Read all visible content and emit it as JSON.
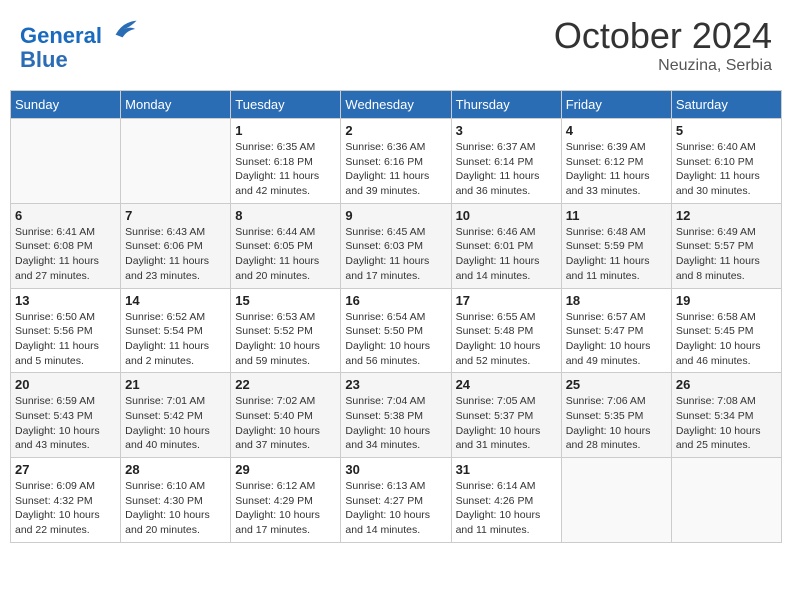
{
  "header": {
    "logo_line1": "General",
    "logo_line2": "Blue",
    "month": "October 2024",
    "location": "Neuzina, Serbia"
  },
  "weekdays": [
    "Sunday",
    "Monday",
    "Tuesday",
    "Wednesday",
    "Thursday",
    "Friday",
    "Saturday"
  ],
  "weeks": [
    [
      {
        "day": "",
        "info": ""
      },
      {
        "day": "",
        "info": ""
      },
      {
        "day": "1",
        "info": "Sunrise: 6:35 AM\nSunset: 6:18 PM\nDaylight: 11 hours and 42 minutes."
      },
      {
        "day": "2",
        "info": "Sunrise: 6:36 AM\nSunset: 6:16 PM\nDaylight: 11 hours and 39 minutes."
      },
      {
        "day": "3",
        "info": "Sunrise: 6:37 AM\nSunset: 6:14 PM\nDaylight: 11 hours and 36 minutes."
      },
      {
        "day": "4",
        "info": "Sunrise: 6:39 AM\nSunset: 6:12 PM\nDaylight: 11 hours and 33 minutes."
      },
      {
        "day": "5",
        "info": "Sunrise: 6:40 AM\nSunset: 6:10 PM\nDaylight: 11 hours and 30 minutes."
      }
    ],
    [
      {
        "day": "6",
        "info": "Sunrise: 6:41 AM\nSunset: 6:08 PM\nDaylight: 11 hours and 27 minutes."
      },
      {
        "day": "7",
        "info": "Sunrise: 6:43 AM\nSunset: 6:06 PM\nDaylight: 11 hours and 23 minutes."
      },
      {
        "day": "8",
        "info": "Sunrise: 6:44 AM\nSunset: 6:05 PM\nDaylight: 11 hours and 20 minutes."
      },
      {
        "day": "9",
        "info": "Sunrise: 6:45 AM\nSunset: 6:03 PM\nDaylight: 11 hours and 17 minutes."
      },
      {
        "day": "10",
        "info": "Sunrise: 6:46 AM\nSunset: 6:01 PM\nDaylight: 11 hours and 14 minutes."
      },
      {
        "day": "11",
        "info": "Sunrise: 6:48 AM\nSunset: 5:59 PM\nDaylight: 11 hours and 11 minutes."
      },
      {
        "day": "12",
        "info": "Sunrise: 6:49 AM\nSunset: 5:57 PM\nDaylight: 11 hours and 8 minutes."
      }
    ],
    [
      {
        "day": "13",
        "info": "Sunrise: 6:50 AM\nSunset: 5:56 PM\nDaylight: 11 hours and 5 minutes."
      },
      {
        "day": "14",
        "info": "Sunrise: 6:52 AM\nSunset: 5:54 PM\nDaylight: 11 hours and 2 minutes."
      },
      {
        "day": "15",
        "info": "Sunrise: 6:53 AM\nSunset: 5:52 PM\nDaylight: 10 hours and 59 minutes."
      },
      {
        "day": "16",
        "info": "Sunrise: 6:54 AM\nSunset: 5:50 PM\nDaylight: 10 hours and 56 minutes."
      },
      {
        "day": "17",
        "info": "Sunrise: 6:55 AM\nSunset: 5:48 PM\nDaylight: 10 hours and 52 minutes."
      },
      {
        "day": "18",
        "info": "Sunrise: 6:57 AM\nSunset: 5:47 PM\nDaylight: 10 hours and 49 minutes."
      },
      {
        "day": "19",
        "info": "Sunrise: 6:58 AM\nSunset: 5:45 PM\nDaylight: 10 hours and 46 minutes."
      }
    ],
    [
      {
        "day": "20",
        "info": "Sunrise: 6:59 AM\nSunset: 5:43 PM\nDaylight: 10 hours and 43 minutes."
      },
      {
        "day": "21",
        "info": "Sunrise: 7:01 AM\nSunset: 5:42 PM\nDaylight: 10 hours and 40 minutes."
      },
      {
        "day": "22",
        "info": "Sunrise: 7:02 AM\nSunset: 5:40 PM\nDaylight: 10 hours and 37 minutes."
      },
      {
        "day": "23",
        "info": "Sunrise: 7:04 AM\nSunset: 5:38 PM\nDaylight: 10 hours and 34 minutes."
      },
      {
        "day": "24",
        "info": "Sunrise: 7:05 AM\nSunset: 5:37 PM\nDaylight: 10 hours and 31 minutes."
      },
      {
        "day": "25",
        "info": "Sunrise: 7:06 AM\nSunset: 5:35 PM\nDaylight: 10 hours and 28 minutes."
      },
      {
        "day": "26",
        "info": "Sunrise: 7:08 AM\nSunset: 5:34 PM\nDaylight: 10 hours and 25 minutes."
      }
    ],
    [
      {
        "day": "27",
        "info": "Sunrise: 6:09 AM\nSunset: 4:32 PM\nDaylight: 10 hours and 22 minutes."
      },
      {
        "day": "28",
        "info": "Sunrise: 6:10 AM\nSunset: 4:30 PM\nDaylight: 10 hours and 20 minutes."
      },
      {
        "day": "29",
        "info": "Sunrise: 6:12 AM\nSunset: 4:29 PM\nDaylight: 10 hours and 17 minutes."
      },
      {
        "day": "30",
        "info": "Sunrise: 6:13 AM\nSunset: 4:27 PM\nDaylight: 10 hours and 14 minutes."
      },
      {
        "day": "31",
        "info": "Sunrise: 6:14 AM\nSunset: 4:26 PM\nDaylight: 10 hours and 11 minutes."
      },
      {
        "day": "",
        "info": ""
      },
      {
        "day": "",
        "info": ""
      }
    ]
  ]
}
